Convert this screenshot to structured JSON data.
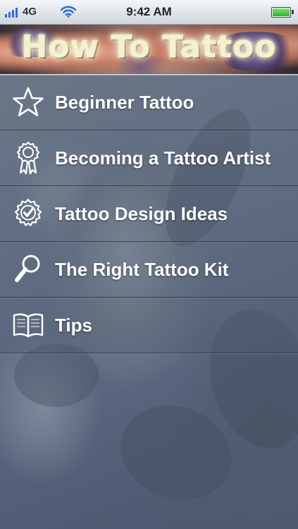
{
  "status_bar": {
    "carrier": "4G",
    "time": "9:42 AM",
    "signal_icon": "signal-bars-icon",
    "wifi_icon": "wifi-icon",
    "battery_icon": "battery-icon"
  },
  "banner": {
    "title": "How To Tattoo"
  },
  "menu": {
    "items": [
      {
        "label": "Beginner Tattoo",
        "icon": "star-icon"
      },
      {
        "label": "Becoming a Tattoo Artist",
        "icon": "ribbon-badge-icon"
      },
      {
        "label": "Tattoo Design Ideas",
        "icon": "check-badge-icon"
      },
      {
        "label": "The Right Tattoo Kit",
        "icon": "magnifier-icon"
      },
      {
        "label": "Tips",
        "icon": "open-book-icon"
      }
    ]
  },
  "colors": {
    "menu_text": "#ffffff",
    "background": "#5f6c7d",
    "signal": "#2d6fd2",
    "battery": "#2fb02a"
  }
}
